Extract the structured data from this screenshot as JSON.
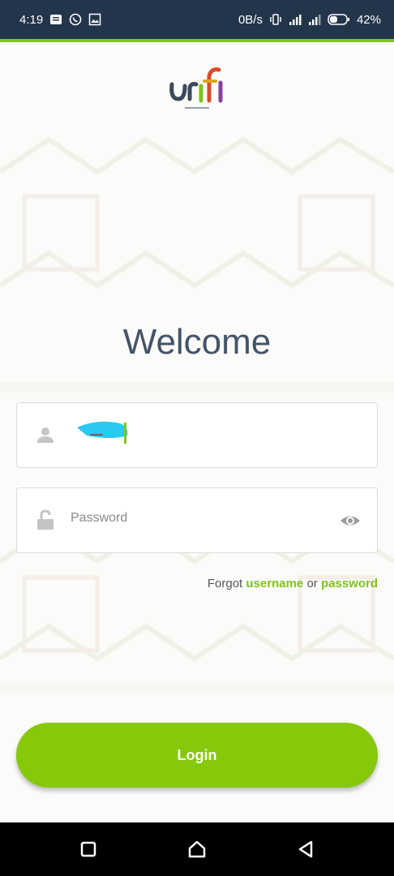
{
  "status_bar": {
    "time": "4:19",
    "net_speed": "0B/s",
    "battery": "42%",
    "icons": [
      "message-icon",
      "whatsapp-icon",
      "gallery-icon",
      "vibrate-icon",
      "signal-icon",
      "signal-icon",
      "battery-icon"
    ]
  },
  "brand": {
    "accent": "#7fc31c",
    "dark": "#22354a"
  },
  "welcome": {
    "title": "Welcome"
  },
  "username": {
    "icon": "user-icon"
  },
  "password": {
    "placeholder": "Password",
    "icon": "unlock-icon",
    "toggle_icon": "eye-icon"
  },
  "forgot": {
    "prefix": "Forgot",
    "username_link": "username",
    "or": "or",
    "password_link": "password"
  },
  "login": {
    "label": "Login"
  },
  "nav": {
    "items": [
      "recents-icon",
      "home-icon",
      "back-icon"
    ]
  }
}
